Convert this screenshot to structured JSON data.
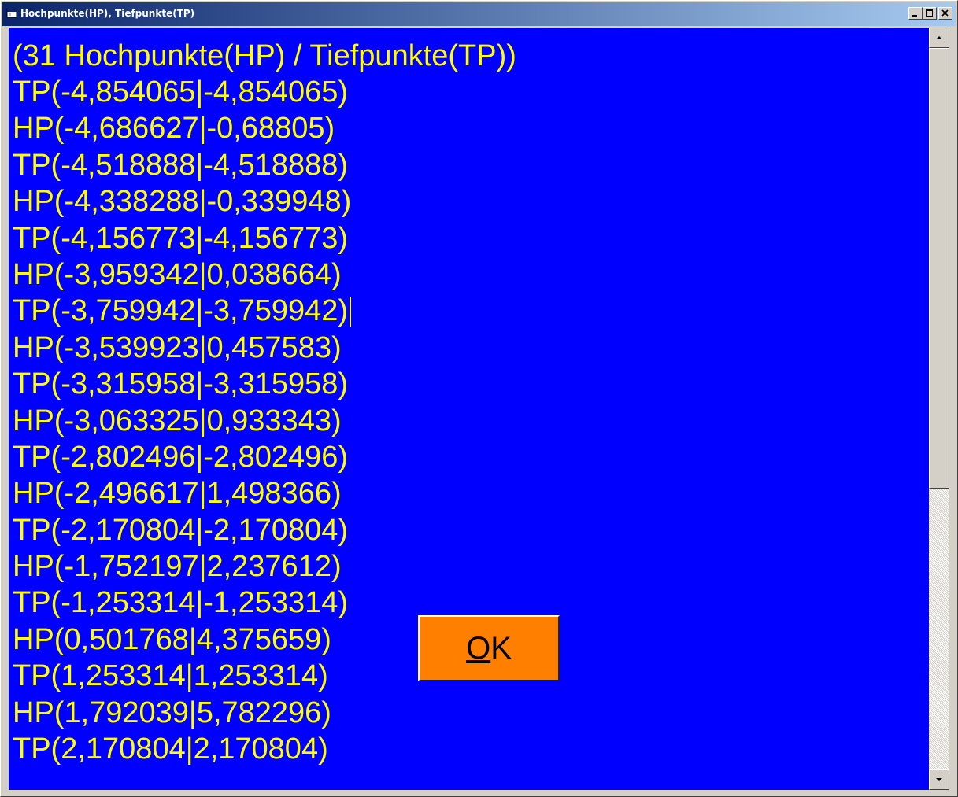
{
  "window": {
    "title": "Hochpunkte(HP), Tiefpunkte(TP)",
    "icon": "app-window-icon",
    "controls": [
      "minimize-icon",
      "maximize-icon",
      "close-icon"
    ]
  },
  "output": {
    "header": "(31 Hochpunkte(HP) / Tiefpunkte(TP))",
    "lines": [
      "TP(-4,854065|-4,854065)",
      "HP(-4,686627|-0,68805)",
      "TP(-4,518888|-4,518888)",
      "HP(-4,338288|-0,339948)",
      "TP(-4,156773|-4,156773)",
      "HP(-3,959342|0,038664)",
      "TP(-3,759942|-3,759942)",
      "HP(-3,539923|0,457583)",
      "TP(-3,315958|-3,315958)",
      "HP(-3,063325|0,933343)",
      "TP(-2,802496|-2,802496)",
      "HP(-2,496617|1,498366)",
      "TP(-2,170804|-2,170804)",
      "HP(-1,752197|2,237612)",
      "TP(-1,253314|-1,253314)",
      "HP(0,501768|4,375659)",
      "TP(1,253314|1,253314)",
      "HP(1,792039|5,782296)",
      "TP(2,170804|2,170804)"
    ]
  },
  "ok_button": {
    "mnemonic": "O",
    "rest": "K"
  },
  "colors": {
    "background": "#0000ff",
    "text": "#ffff00",
    "button": "#ff8000"
  }
}
